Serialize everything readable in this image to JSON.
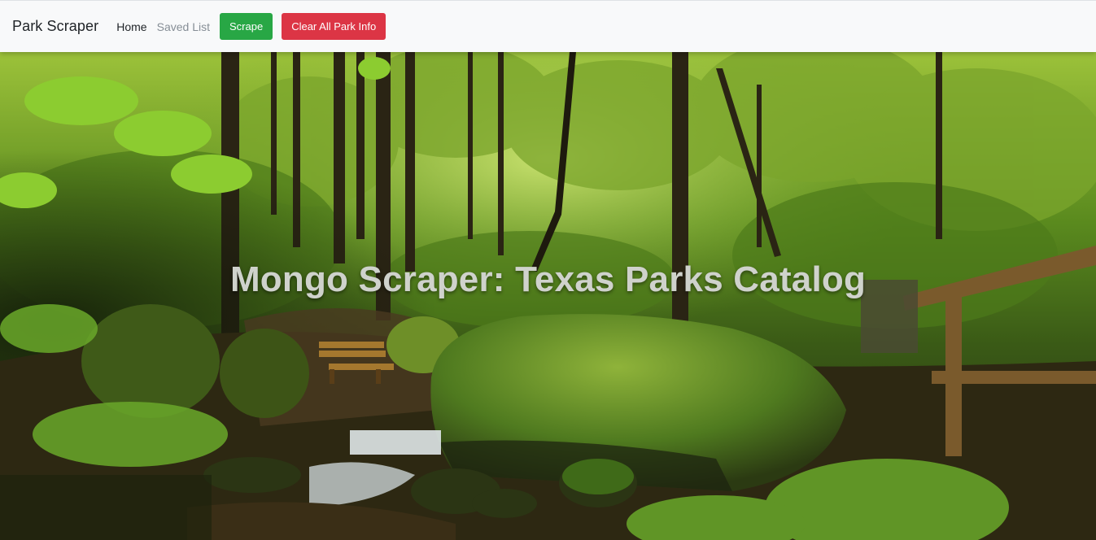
{
  "navbar": {
    "brand": "Park Scraper",
    "links": [
      {
        "label": "Home",
        "state": "active"
      },
      {
        "label": "Saved List",
        "state": "muted"
      }
    ],
    "scrape_button": {
      "label": "Scrape",
      "color": "#28a745"
    },
    "clear_button": {
      "label": "Clear All Park Info",
      "color": "#dc3545"
    }
  },
  "hero": {
    "title": "Mongo Scraper: Texas Parks Catalog",
    "background": "forest-stream-photo"
  }
}
